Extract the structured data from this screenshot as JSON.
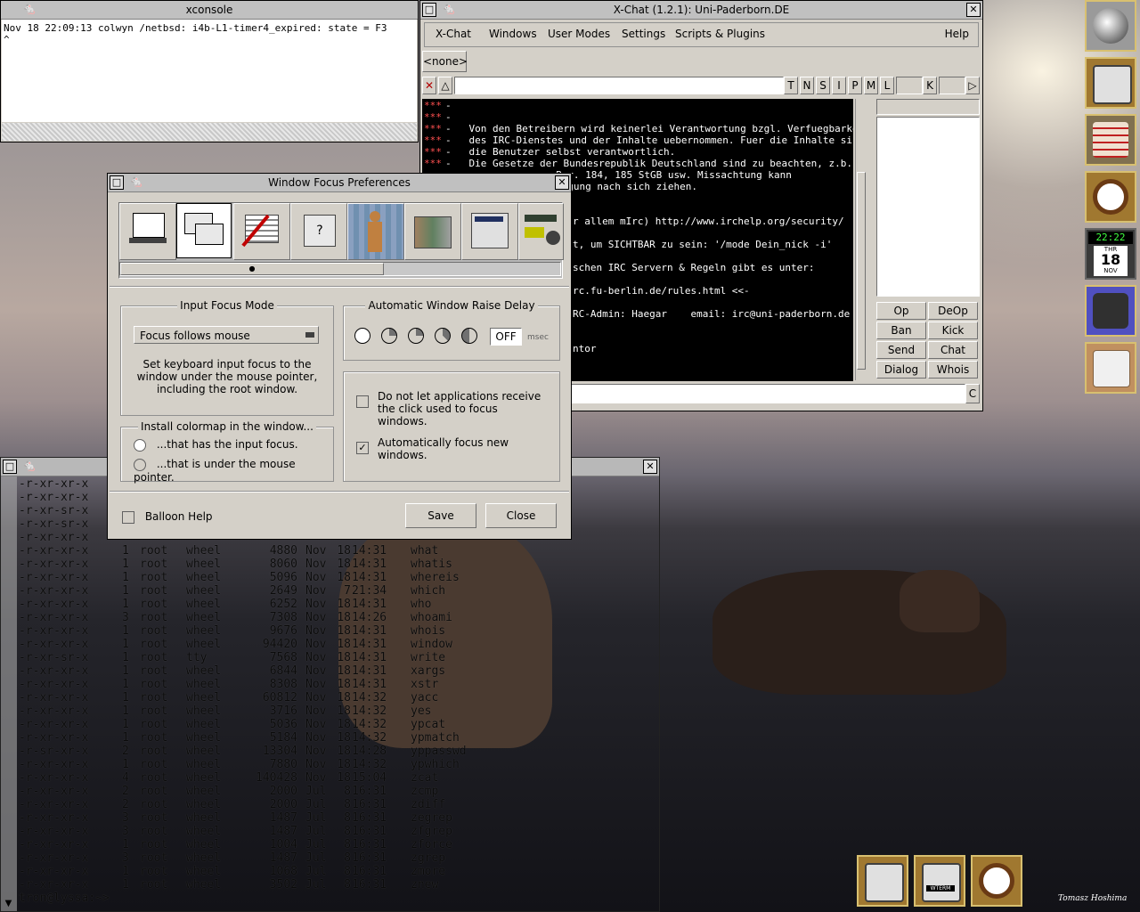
{
  "xconsole": {
    "title": "xconsole",
    "line1": "Nov 18 22:09:13 colwyn /netbsd: i4b-L1-timer4_expired: state = F3",
    "line2": "^"
  },
  "xchat": {
    "title": "X-Chat (1.2.1): Uni-Paderborn.DE",
    "menu": [
      "X-Chat",
      "Windows",
      "User Modes",
      "Settings",
      "Scripts & Plugins"
    ],
    "help": "Help",
    "tab": "<none>",
    "mode_buttons": [
      "T",
      "N",
      "S",
      "I",
      "P",
      "M",
      "L",
      "K"
    ],
    "messages": [
      {
        "prefix": "***",
        "text": "-"
      },
      {
        "prefix": "***",
        "text": "-"
      },
      {
        "prefix": "***",
        "text": "-   Von den Betreibern wird keinerlei Verantwortung bzgl. Verfuegbarkeit"
      },
      {
        "prefix": "***",
        "text": "-   des IRC-Dienstes und der Inhalte uebernommen. Fuer die Inhalte sind"
      },
      {
        "prefix": "***",
        "text": "-   die Benutzer selbst verantwortlich."
      },
      {
        "prefix": "***",
        "text": "-   Die Gesetze der Bundesrepublik Deutschland sind zu beachten, z.b."
      },
      {
        "prefix": "",
        "text": "Par. 184, 185 StGB usw. Missachtung kann"
      },
      {
        "prefix": "",
        "text": "olgung nach sich ziehen."
      },
      {
        "prefix": "",
        "text": ""
      },
      {
        "prefix": "",
        "text": ""
      },
      {
        "prefix": "",
        "text": "r allem mIrc) http://www.irchelp.org/security/"
      },
      {
        "prefix": "",
        "text": ""
      },
      {
        "prefix": "",
        "text": "t, um SICHTBAR zu sein: '/mode Dein_nick -i'"
      },
      {
        "prefix": "",
        "text": ""
      },
      {
        "prefix": "",
        "text": "schen IRC Servern & Regeln gibt es unter:"
      },
      {
        "prefix": "",
        "text": ""
      },
      {
        "prefix": "",
        "text": "rc.fu-berlin.de/rules.html <<-"
      },
      {
        "prefix": "",
        "text": ""
      },
      {
        "prefix": "",
        "text": "RC-Admin: Haegar    email: irc@uni-paderborn.de"
      },
      {
        "prefix": "",
        "text": ""
      },
      {
        "prefix": "",
        "text": ""
      },
      {
        "prefix": "",
        "text": "ntor"
      }
    ],
    "user_buttons": [
      "Op",
      "DeOp",
      "Ban",
      "Kick",
      "Send",
      "Chat",
      "Dialog",
      "Whois"
    ],
    "clear_btn": "C"
  },
  "focus_prefs": {
    "title": "Window Focus Preferences",
    "input_focus_group": "Input Focus Mode",
    "focus_mode": "Focus follows mouse",
    "focus_desc": "Set keyboard input focus to the window under the mouse pointer, including the root window.",
    "colormap_group": "Install colormap in the window...",
    "colormap_options": [
      "...that has the input focus.",
      "...that is under the mouse pointer."
    ],
    "raise_group": "Automatic Window Raise Delay",
    "raise_value": "OFF",
    "raise_unit": "msec",
    "opt_click": "Do not let applications receive the click used to focus windows.",
    "opt_autofocus": "Automatically focus new windows.",
    "balloon": "Balloon Help",
    "save": "Save",
    "close": "Close"
  },
  "terminal": {
    "partial_rows": [
      "-r-xr-xr-x",
      "-r-xr-xr-x",
      "-r-xr-sr-x",
      "-r-xr-sr-x",
      "-r-xr-xr-x"
    ],
    "rows": [
      {
        "perm": "-r-xr-xr-x",
        "n": "1",
        "user": "root",
        "group": "wheel",
        "size": "4880",
        "mon": "Nov",
        "day": "18",
        "time": "14:31",
        "name": "what"
      },
      {
        "perm": "-r-xr-xr-x",
        "n": "1",
        "user": "root",
        "group": "wheel",
        "size": "8060",
        "mon": "Nov",
        "day": "18",
        "time": "14:31",
        "name": "whatis"
      },
      {
        "perm": "-r-xr-xr-x",
        "n": "1",
        "user": "root",
        "group": "wheel",
        "size": "5096",
        "mon": "Nov",
        "day": "18",
        "time": "14:31",
        "name": "whereis"
      },
      {
        "perm": "-r-xr-xr-x",
        "n": "1",
        "user": "root",
        "group": "wheel",
        "size": "2649",
        "mon": "Nov",
        "day": "7",
        "time": "21:34",
        "name": "which"
      },
      {
        "perm": "-r-xr-xr-x",
        "n": "1",
        "user": "root",
        "group": "wheel",
        "size": "6252",
        "mon": "Nov",
        "day": "18",
        "time": "14:31",
        "name": "who"
      },
      {
        "perm": "-r-xr-xr-x",
        "n": "3",
        "user": "root",
        "group": "wheel",
        "size": "7308",
        "mon": "Nov",
        "day": "18",
        "time": "14:26",
        "name": "whoami"
      },
      {
        "perm": "-r-xr-xr-x",
        "n": "1",
        "user": "root",
        "group": "wheel",
        "size": "9676",
        "mon": "Nov",
        "day": "18",
        "time": "14:31",
        "name": "whois"
      },
      {
        "perm": "-r-xr-xr-x",
        "n": "1",
        "user": "root",
        "group": "wheel",
        "size": "94420",
        "mon": "Nov",
        "day": "18",
        "time": "14:31",
        "name": "window"
      },
      {
        "perm": "-r-xr-sr-x",
        "n": "1",
        "user": "root",
        "group": "tty",
        "size": "7568",
        "mon": "Nov",
        "day": "18",
        "time": "14:31",
        "name": "write"
      },
      {
        "perm": "-r-xr-xr-x",
        "n": "1",
        "user": "root",
        "group": "wheel",
        "size": "6844",
        "mon": "Nov",
        "day": "18",
        "time": "14:31",
        "name": "xargs"
      },
      {
        "perm": "-r-xr-xr-x",
        "n": "1",
        "user": "root",
        "group": "wheel",
        "size": "8308",
        "mon": "Nov",
        "day": "18",
        "time": "14:31",
        "name": "xstr"
      },
      {
        "perm": "-r-xr-xr-x",
        "n": "1",
        "user": "root",
        "group": "wheel",
        "size": "60812",
        "mon": "Nov",
        "day": "18",
        "time": "14:32",
        "name": "yacc"
      },
      {
        "perm": "-r-xr-xr-x",
        "n": "1",
        "user": "root",
        "group": "wheel",
        "size": "3716",
        "mon": "Nov",
        "day": "18",
        "time": "14:32",
        "name": "yes"
      },
      {
        "perm": "-r-xr-xr-x",
        "n": "1",
        "user": "root",
        "group": "wheel",
        "size": "5036",
        "mon": "Nov",
        "day": "18",
        "time": "14:32",
        "name": "ypcat"
      },
      {
        "perm": "-r-xr-xr-x",
        "n": "1",
        "user": "root",
        "group": "wheel",
        "size": "5184",
        "mon": "Nov",
        "day": "18",
        "time": "14:32",
        "name": "ypmatch"
      },
      {
        "perm": "-r-sr-xr-x",
        "n": "2",
        "user": "root",
        "group": "wheel",
        "size": "13304",
        "mon": "Nov",
        "day": "18",
        "time": "14:28",
        "name": "yppasswd"
      },
      {
        "perm": "-r-xr-xr-x",
        "n": "1",
        "user": "root",
        "group": "wheel",
        "size": "7880",
        "mon": "Nov",
        "day": "18",
        "time": "14:32",
        "name": "ypwhich"
      },
      {
        "perm": "-r-xr-xr-x",
        "n": "4",
        "user": "root",
        "group": "wheel",
        "size": "140428",
        "mon": "Nov",
        "day": "18",
        "time": "15:04",
        "name": "zcat"
      },
      {
        "perm": "-r-xr-xr-x",
        "n": "2",
        "user": "root",
        "group": "wheel",
        "size": "2000",
        "mon": "Jul",
        "day": "8",
        "time": "16:31",
        "name": "zcmp"
      },
      {
        "perm": "-r-xr-xr-x",
        "n": "2",
        "user": "root",
        "group": "wheel",
        "size": "2000",
        "mon": "Jul",
        "day": "8",
        "time": "16:31",
        "name": "zdiff"
      },
      {
        "perm": "-r-xr-xr-x",
        "n": "3",
        "user": "root",
        "group": "wheel",
        "size": "1487",
        "mon": "Jul",
        "day": "8",
        "time": "16:31",
        "name": "zegrep"
      },
      {
        "perm": "-r-xr-xr-x",
        "n": "3",
        "user": "root",
        "group": "wheel",
        "size": "1487",
        "mon": "Jul",
        "day": "8",
        "time": "16:31",
        "name": "zfgrep"
      },
      {
        "perm": "-r-xr-xr-x",
        "n": "1",
        "user": "root",
        "group": "wheel",
        "size": "1004",
        "mon": "Jul",
        "day": "8",
        "time": "16:31",
        "name": "zforce"
      },
      {
        "perm": "-r-xr-xr-x",
        "n": "3",
        "user": "root",
        "group": "wheel",
        "size": "1487",
        "mon": "Jul",
        "day": "8",
        "time": "16:31",
        "name": "zgrep"
      },
      {
        "perm": "-r-xr-xr-x",
        "n": "1",
        "user": "root",
        "group": "wheel",
        "size": "1068",
        "mon": "Jul",
        "day": "8",
        "time": "16:31",
        "name": "zmore"
      },
      {
        "perm": "-r-xr-xr-x",
        "n": "1",
        "user": "root",
        "group": "wheel",
        "size": "3502",
        "mon": "Jul",
        "day": "8",
        "time": "16:31",
        "name": "znew"
      }
    ],
    "prompt": "tron@lyssa:~> "
  },
  "dock": {
    "clock": "22:22",
    "cal_day": "THR",
    "cal_date": "18",
    "cal_month": "NOV",
    "wterm_label": "WTERM"
  },
  "signature": "Tomasz Hoshima"
}
